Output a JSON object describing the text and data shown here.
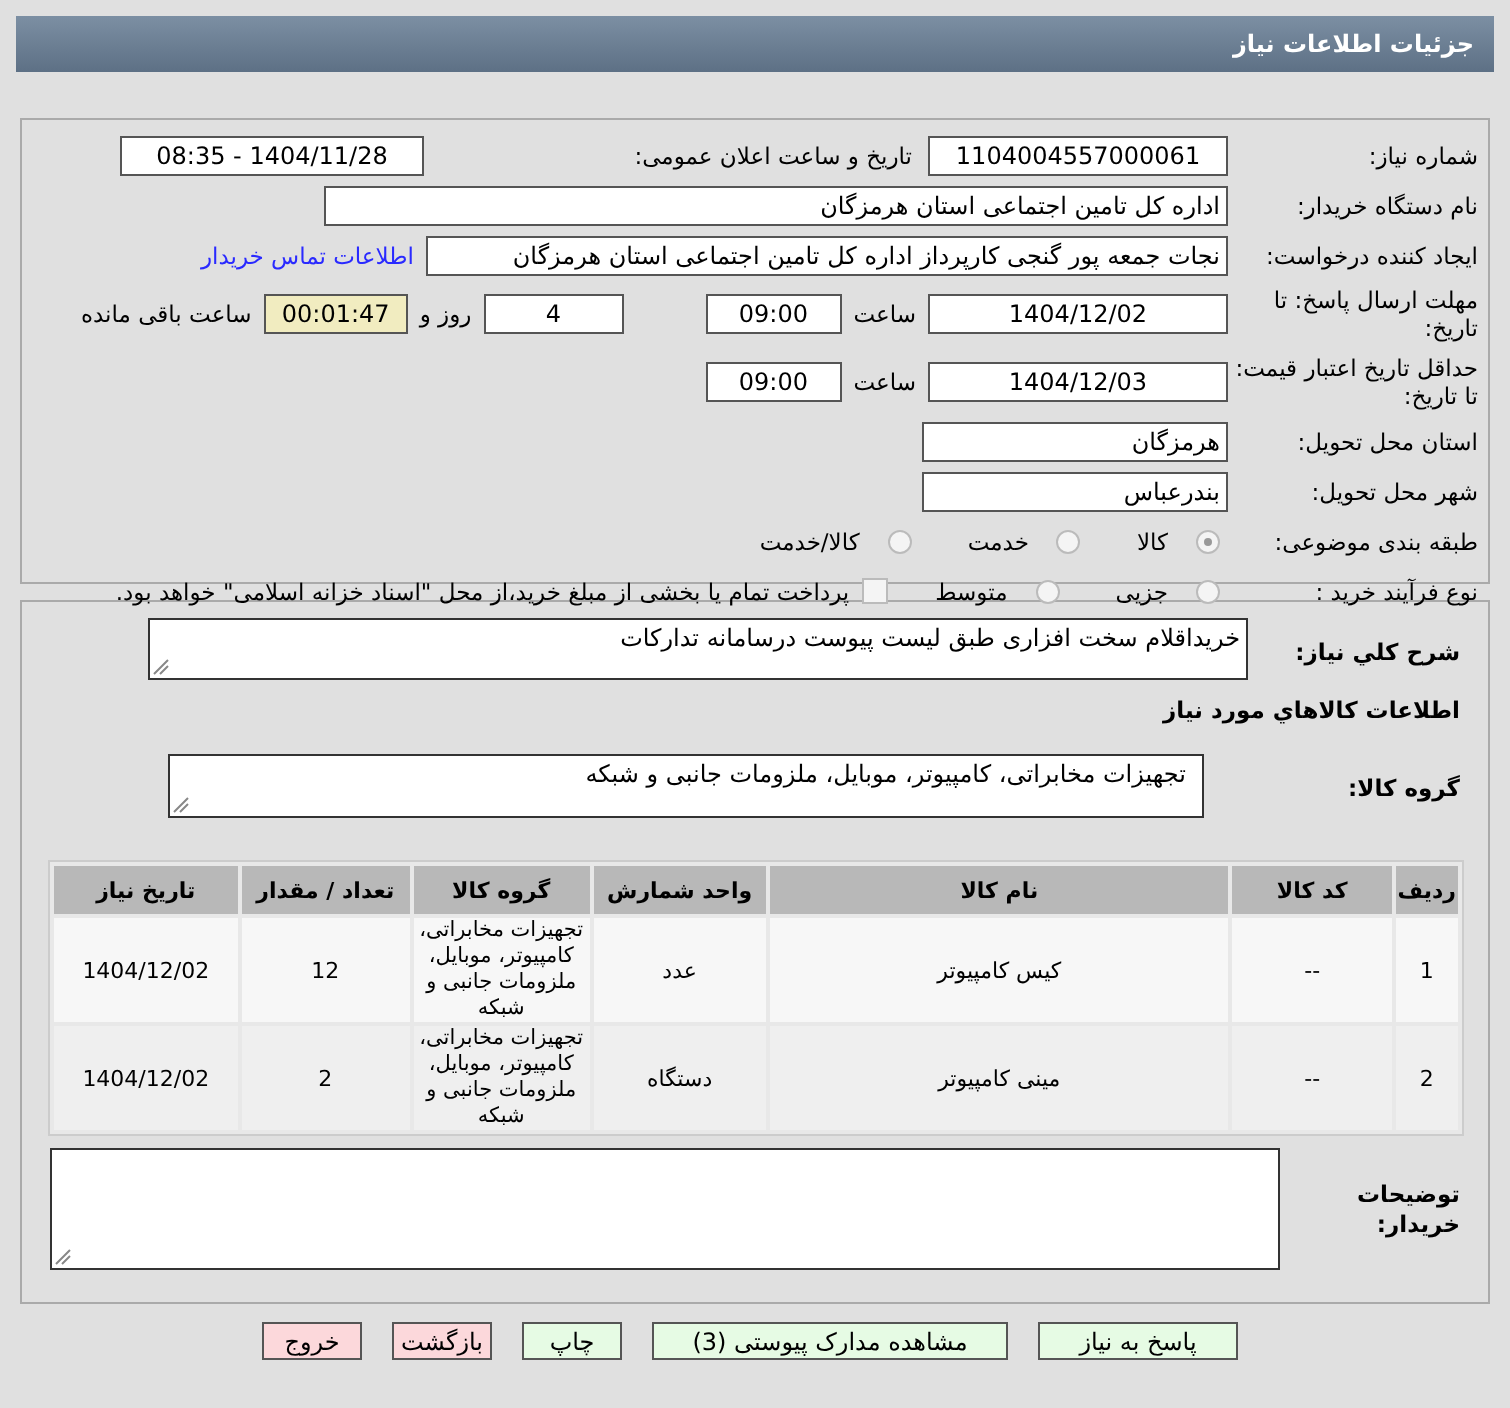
{
  "title": "جزئیات اطلاعات نیاز",
  "fields": {
    "need_number": {
      "label": "شماره نیاز:",
      "value": "1104004557000061"
    },
    "announce": {
      "label": "تاریخ و ساعت اعلان عمومی:",
      "value": "1404/11/28 - 08:35"
    },
    "buyer": {
      "label": "نام دستگاه خریدار:",
      "value": "اداره کل تامین اجتماعی استان هرمزگان"
    },
    "creator": {
      "label": "ایجاد کننده درخواست:",
      "value": "نجات جمعه پور گنجی  کارپرداز اداره کل تامین اجتماعی استان هرمزگان",
      "link": "اطلاعات تماس خریدار"
    },
    "deadline": {
      "label": "مهلت ارسال پاسخ: تا تاریخ:",
      "date": "1404/12/02",
      "time_label": "ساعت",
      "time": "09:00",
      "days": "4",
      "days_label": "روز و",
      "remaining": "00:01:47",
      "remaining_label": "ساعت باقی مانده"
    },
    "validity": {
      "label": "حداقل تاریخ اعتبار قیمت: تا تاریخ:",
      "date": "1404/12/03",
      "time_label": "ساعت",
      "time": "09:00"
    },
    "province": {
      "label": "استان محل تحویل:",
      "value": "هرمزگان"
    },
    "city": {
      "label": "شهر محل تحویل:",
      "value": "بندرعباس"
    }
  },
  "category": {
    "label": "طبقه بندی موضوعی:",
    "options": [
      {
        "label": "کالا",
        "selected": true
      },
      {
        "label": "خدمت",
        "selected": false
      },
      {
        "label": "کالا/خدمت",
        "selected": false
      }
    ]
  },
  "purchase_type": {
    "label": "نوع فرآیند خرید :",
    "options": [
      {
        "label": "جزیی",
        "selected": false
      },
      {
        "label": "متوسط",
        "selected": false
      }
    ],
    "checkbox": {
      "label": "پرداخت تمام یا بخشی از مبلغ خرید،از محل \"اسناد خزانه اسلامی\" خواهد بود.",
      "checked": false
    }
  },
  "description": {
    "label": "شرح کلي نياز:",
    "value": "خریداقلام سخت افزاری طبق لیست پیوست درسامانه تدارکات"
  },
  "goods_heading": "اطلاعات کالاهاي مورد نياز",
  "goods_group": {
    "label": "گروه کالا:",
    "value": "تجهیزات مخابراتی، کامپیوتر، موبایل، ملزومات جانبی و شبکه"
  },
  "table": {
    "columns": [
      "ردیف",
      "کد کالا",
      "نام کالا",
      "واحد شمارش",
      "گروه کالا",
      "تعداد / مقدار",
      "تاریخ نیاز"
    ],
    "rows": [
      [
        "1",
        "--",
        "کیس کامپیوتر",
        "عدد",
        "تجهیزات مخابراتی، کامپیوتر، موبایل، ملزومات جانبی و شبکه",
        "12",
        "1404/12/02"
      ],
      [
        "2",
        "--",
        "مینی کامپیوتر",
        "دستگاه",
        "تجهیزات مخابراتی، کامپیوتر، موبایل، ملزومات جانبی و شبکه",
        "2",
        "1404/12/02"
      ]
    ]
  },
  "buyer_notes": {
    "label": "توضیحات خریدار:"
  },
  "buttons": [
    {
      "label": "پاسخ به نیاز",
      "kind": "action"
    },
    {
      "label": "مشاهده مدارک پیوستی (3)",
      "kind": "action"
    },
    {
      "label": "چاپ",
      "kind": "action"
    },
    {
      "label": "بازگشت",
      "kind": "exit"
    },
    {
      "label": "خروج",
      "kind": "exit"
    }
  ]
}
